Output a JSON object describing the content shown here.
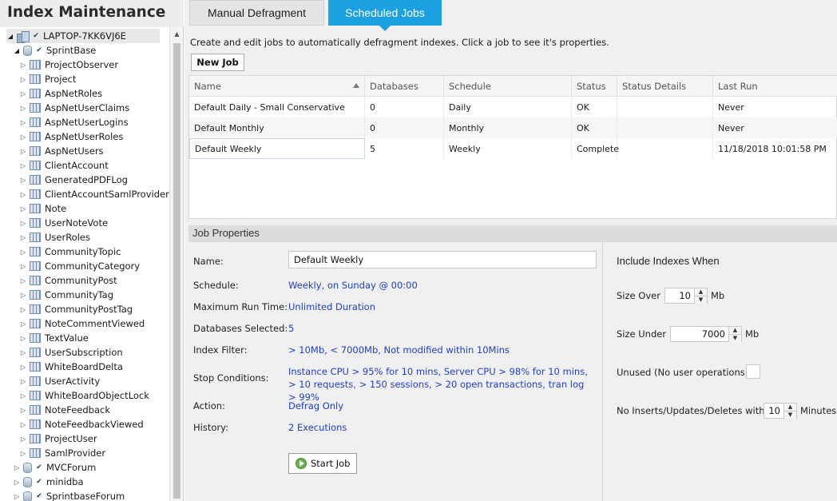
{
  "left_panel": {
    "title": "Index Maintenance",
    "server": "LAPTOP-7KK6VJ6E",
    "databases": [
      {
        "name": "SprintBase",
        "expanded": true,
        "tables": [
          "ProjectObserver",
          "Project",
          "AspNetRoles",
          "AspNetUserClaims",
          "AspNetUserLogins",
          "AspNetUserRoles",
          "AspNetUsers",
          "ClientAccount",
          "GeneratedPDFLog",
          "ClientAccountSamlProvider",
          "Note",
          "UserNoteVote",
          "UserRoles",
          "CommunityTopic",
          "CommunityCategory",
          "CommunityPost",
          "CommunityTag",
          "CommunityPostTag",
          "NoteCommentViewed",
          "TextValue",
          "UserSubscription",
          "WhiteBoardDelta",
          "UserActivity",
          "WhiteBoardObjectLock",
          "NoteFeedback",
          "NoteFeedbackViewed",
          "ProjectUser",
          "SamlProvider"
        ]
      },
      {
        "name": "MVCForum",
        "expanded": false
      },
      {
        "name": "minidba",
        "expanded": false
      },
      {
        "name": "SprintbaseForum",
        "expanded": false
      }
    ]
  },
  "tabs": [
    {
      "label": "Manual Defragment",
      "active": false
    },
    {
      "label": "Scheduled Jobs",
      "active": true
    }
  ],
  "description": "Create and edit jobs to automatically defragment indexes. Click a job to see it's properties.",
  "new_job_label": "New Job",
  "grid": {
    "columns": [
      "Name",
      "Databases",
      "Schedule",
      "Status",
      "Status Details",
      "Last Run"
    ],
    "rows": [
      [
        "Default Daily - Small Conservative",
        "0",
        "Daily",
        "OK",
        "",
        "Never"
      ],
      [
        "Default Monthly",
        "0",
        "Monthly",
        "OK",
        "",
        "Never"
      ],
      [
        "Default Weekly",
        "5",
        "Weekly",
        "Complete",
        "",
        "11/18/2018 10:01:58 PM"
      ]
    ],
    "selected_row": 2
  },
  "job_properties": {
    "header": "Job Properties",
    "name_label": "Name:",
    "name_value": "Default Weekly",
    "schedule_label": "Schedule:",
    "schedule_value": "Weekly, on Sunday @ 00:00",
    "max_run_label": "Maximum Run Time:",
    "max_run_value": "Unlimited Duration",
    "databases_label": "Databases Selected:",
    "databases_value": "5",
    "index_filter_label": "Index Filter:",
    "index_filter_value": "> 10Mb, < 7000Mb, Not modified within 10Mins",
    "stop_label": "Stop Conditions:",
    "stop_value": "Instance CPU > 95% for 10 mins, Server CPU > 98% for 10 mins, > 10 requests, > 150 sessions, > 20 open transactions, tran log > 99%",
    "action_label": "Action:",
    "action_value": "Defrag Only",
    "history_label": "History:",
    "history_value": "2 Executions",
    "start_job_label": "Start Job"
  },
  "include_indexes": {
    "title": "Include Indexes When",
    "size_over_label": "Size Over",
    "size_over_value": "10",
    "size_over_unit": "Mb",
    "size_under_label": "Size Under",
    "size_under_value": "7000",
    "size_under_unit": "Mb",
    "unused_label": "Unused (No user operations)",
    "no_inserts_label": "No Inserts/Updates/Deletes within",
    "no_inserts_value": "10",
    "no_inserts_unit": "Minutes"
  },
  "colors": {
    "active_tab": "#1ba1e2",
    "link_text": "#1e3ec8"
  }
}
